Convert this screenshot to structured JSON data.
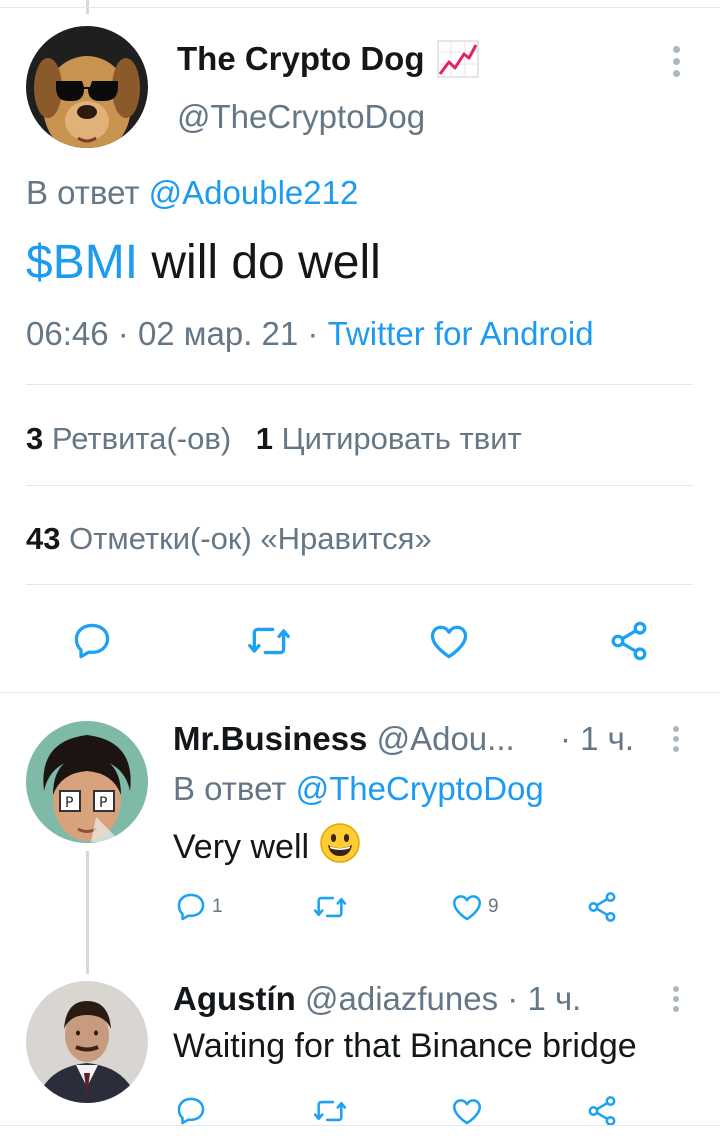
{
  "tweet": {
    "author_name": "The Crypto Dog",
    "author_handle": "@TheCryptoDog",
    "reply_prefix": "В ответ",
    "reply_to": "@Adouble212",
    "cashtag": "$BMI",
    "text": " will do well",
    "time": "06:46",
    "date": "02 мар. 21",
    "separator": "·",
    "source": "Twitter for Android",
    "stats": {
      "retweets_count": "3",
      "retweets_label": "Ретвита(-ов)",
      "quotes_count": "1",
      "quotes_label": "Цитировать твит",
      "likes_count": "43",
      "likes_label": "Отметки(-ок) «Нравится»"
    },
    "icons": [
      "reply-icon",
      "retweet-icon",
      "like-icon",
      "share-icon",
      "chart-emoji-icon"
    ]
  },
  "replies": [
    {
      "name": "Mr.Business",
      "handle": "@Adou...",
      "time": "· 1 ч.",
      "reply_prefix": "В ответ",
      "reply_to": "@TheCryptoDog",
      "text": "Very well",
      "reply_count": "1",
      "like_count": "9",
      "emoji": "grinning-face-emoji"
    },
    {
      "name": "Agustín",
      "handle": "@adiazfunes",
      "time": "· 1 ч.",
      "text": "Waiting for that Binance bridge"
    }
  ],
  "colors": {
    "link": "#1d9bf0",
    "muted": "#657786",
    "divider": "#e1e8ed",
    "icon": "#1da1f2"
  }
}
